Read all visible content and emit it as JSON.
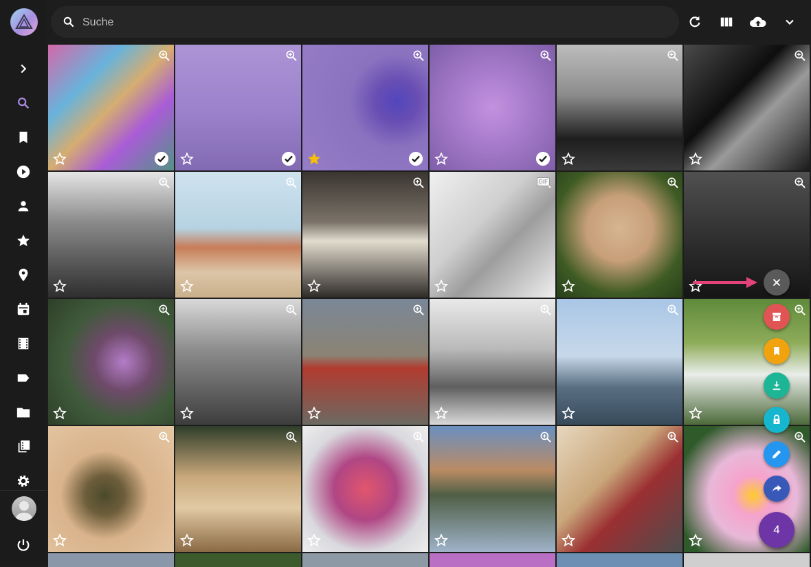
{
  "search": {
    "placeholder": "Suche",
    "value": ""
  },
  "sidebar": {
    "items": [
      {
        "icon": "expand-icon"
      },
      {
        "icon": "search-icon",
        "active": true
      },
      {
        "icon": "bookmark-icon"
      },
      {
        "icon": "play-icon"
      },
      {
        "icon": "person-icon"
      },
      {
        "icon": "star-icon"
      },
      {
        "icon": "location-icon"
      },
      {
        "icon": "calendar-icon"
      },
      {
        "icon": "film-icon"
      },
      {
        "icon": "label-icon"
      },
      {
        "icon": "folder-icon"
      },
      {
        "icon": "library-icon"
      },
      {
        "icon": "settings-icon"
      }
    ]
  },
  "toolbar": {
    "icons": [
      "refresh-icon",
      "view-columns-icon",
      "upload-icon",
      "chevron-down-icon"
    ]
  },
  "photos": [
    {
      "name": "psychedelic-art",
      "selected": true,
      "favorite": false
    },
    {
      "name": "clock-tower",
      "selected": true,
      "favorite": false
    },
    {
      "name": "peacock",
      "selected": true,
      "favorite": true
    },
    {
      "name": "dahlia",
      "selected": true,
      "favorite": false
    },
    {
      "name": "castle-silhouette",
      "selected": false,
      "favorite": false
    },
    {
      "name": "dark-interior",
      "selected": false,
      "favorite": false
    },
    {
      "name": "glass-dome",
      "selected": false,
      "favorite": false
    },
    {
      "name": "ferris-wheel-beach",
      "selected": false,
      "favorite": false
    },
    {
      "name": "pier-underside",
      "selected": false,
      "favorite": false
    },
    {
      "name": "newtons-cradle",
      "selected": false,
      "favorite": false,
      "badge": "GIF"
    },
    {
      "name": "puppy",
      "selected": false,
      "favorite": false
    },
    {
      "name": "man-in-suit",
      "selected": false,
      "favorite": false
    },
    {
      "name": "succulent-flowers",
      "selected": false,
      "favorite": false
    },
    {
      "name": "city-skyline",
      "selected": false,
      "favorite": false
    },
    {
      "name": "wooden-house",
      "selected": false,
      "favorite": false
    },
    {
      "name": "bridge",
      "selected": false,
      "favorite": false
    },
    {
      "name": "harbor-tower",
      "selected": false,
      "favorite": false
    },
    {
      "name": "swan-boats",
      "selected": false,
      "favorite": false
    },
    {
      "name": "dung-beetle",
      "selected": false,
      "favorite": false
    },
    {
      "name": "lying-puppy",
      "selected": false,
      "favorite": false
    },
    {
      "name": "red-plants",
      "selected": false,
      "favorite": false
    },
    {
      "name": "reflection",
      "selected": false,
      "favorite": false
    },
    {
      "name": "pastries",
      "selected": false,
      "favorite": false
    },
    {
      "name": "pink-flower",
      "selected": false,
      "favorite": false
    }
  ],
  "actions": {
    "count": "4",
    "buttons": [
      {
        "icon": "close-icon",
        "color": "#5a5a5a"
      },
      {
        "icon": "archive-icon",
        "color": "#e05453"
      },
      {
        "icon": "bookmark-icon",
        "color": "#f0a20f"
      },
      {
        "icon": "download-icon",
        "color": "#1cb596"
      },
      {
        "icon": "lock-icon",
        "color": "#17b6cf"
      },
      {
        "icon": "edit-icon",
        "color": "#2496ef"
      },
      {
        "icon": "share-icon",
        "color": "#3959b8"
      }
    ],
    "count_color": "#6d35a6",
    "arrow_color": "#e4427a"
  },
  "colors": {
    "accent": "#a98be0",
    "background": "#1d1d1d"
  }
}
